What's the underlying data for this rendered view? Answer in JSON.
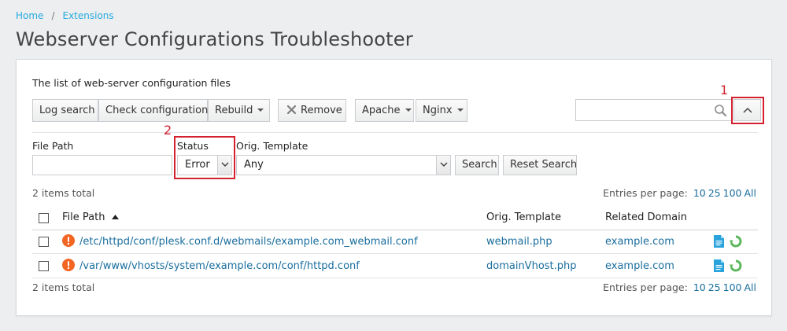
{
  "breadcrumb": {
    "home": "Home",
    "separator": "/",
    "current": "Extensions"
  },
  "page_title": "Webserver Configurations Troubleshooter",
  "panel": {
    "description": "The list of web-server configuration files",
    "toolbar": {
      "log_search": "Log search",
      "check_configuration": "Check configuration",
      "rebuild": "Rebuild",
      "remove": "Remove",
      "apache": "Apache",
      "nginx": "Nginx"
    },
    "search": {
      "value": ""
    },
    "annotations": {
      "first": "1",
      "second": "2"
    },
    "filters": {
      "file_path_label": "File Path",
      "file_path_value": "",
      "status_label": "Status",
      "status_value": "Error",
      "template_label": "Orig. Template",
      "template_value": "Any",
      "search_button": "Search",
      "reset_button": "Reset Search"
    },
    "items_total": "2 items total",
    "entries_per_page": {
      "label": "Entries per page:",
      "options": [
        "10",
        "25",
        "100",
        "All"
      ]
    },
    "table": {
      "headers": {
        "file_path": "File Path",
        "template": "Orig. Template",
        "domain": "Related Domain"
      },
      "rows": [
        {
          "path": "/etc/httpd/conf/plesk.conf.d/webmails/example.com_webmail.conf",
          "template": "webmail.php",
          "domain": "example.com"
        },
        {
          "path": "/var/www/vhosts/system/example.com/conf/httpd.conf",
          "template": "domainVhost.php",
          "domain": "example.com"
        }
      ]
    },
    "colors": {
      "link": "#1a6e9e",
      "error": "#f26522",
      "highlight": "#d3212f",
      "breadcrumb": "#28aade"
    }
  }
}
